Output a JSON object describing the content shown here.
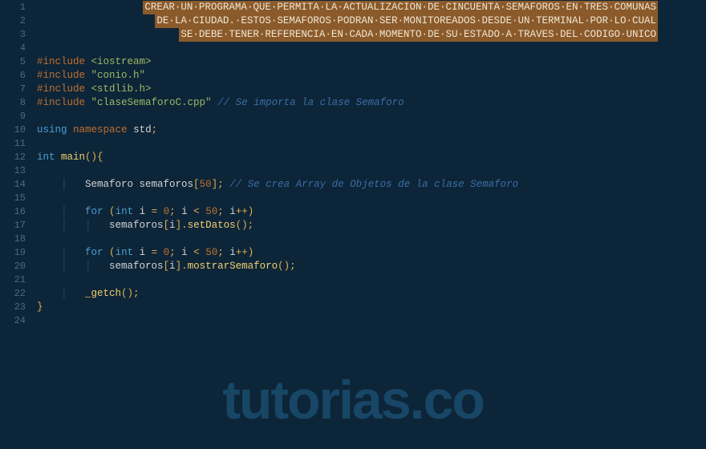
{
  "watermark": "tutorias.co",
  "lines": [
    {
      "num": "1",
      "type": "banner",
      "indent": 1,
      "text": "CREAR UN PROGRAMA QUE PERMITA LA ACTUALIZACION DE CINCUENTA SEMAFOROS EN TRES COMUNAS"
    },
    {
      "num": "2",
      "type": "banner",
      "indent": 1,
      "text": "DE LA CIUDAD. ESTOS SEMAFOROS PODRAN SER MONITOREADOS DESDE UN TERMINAL POR LO CUAL"
    },
    {
      "num": "3",
      "type": "banner",
      "indent": 1,
      "text": "SE DEBE TENER REFERENCIA EN CADA MOMENTO DE SU ESTADO A TRAVES DEL CODIGO UNICO"
    },
    {
      "num": "4",
      "type": "blank"
    },
    {
      "num": "5",
      "type": "include_angle",
      "file": "iostream"
    },
    {
      "num": "6",
      "type": "include_quote",
      "file": "conio.h"
    },
    {
      "num": "7",
      "type": "include_angle",
      "file": "stdlib.h"
    },
    {
      "num": "8",
      "type": "include_quote_comment",
      "file": "claseSemaforoC.cpp",
      "comment": "// Se importa la clase Semaforo"
    },
    {
      "num": "9",
      "type": "blank"
    },
    {
      "num": "10",
      "type": "using",
      "text_using": "using",
      "text_namespace": "namespace",
      "text_std": "std"
    },
    {
      "num": "11",
      "type": "blank"
    },
    {
      "num": "12",
      "type": "main",
      "int": "int",
      "main": "main"
    },
    {
      "num": "13",
      "type": "blank"
    },
    {
      "num": "14",
      "type": "decl",
      "cls": "Semaforo",
      "var": "semaforos",
      "num_v": "50",
      "comment": "// Se crea Array de Objetos de la clase Semaforo"
    },
    {
      "num": "15",
      "type": "blank"
    },
    {
      "num": "16",
      "type": "for",
      "kw_for": "for",
      "kw_int": "int",
      "var": "i",
      "zero": "0",
      "lim": "50"
    },
    {
      "num": "17",
      "type": "call",
      "arr": "semaforos",
      "idx": "i",
      "method": "setDatos"
    },
    {
      "num": "18",
      "type": "blank"
    },
    {
      "num": "19",
      "type": "for",
      "kw_for": "for",
      "kw_int": "int",
      "var": "i",
      "zero": "0",
      "lim": "50"
    },
    {
      "num": "20",
      "type": "call",
      "arr": "semaforos",
      "idx": "i",
      "method": "mostrarSemaforo"
    },
    {
      "num": "21",
      "type": "blank"
    },
    {
      "num": "22",
      "type": "getch",
      "fn": "_getch"
    },
    {
      "num": "23",
      "type": "closebrace"
    },
    {
      "num": "24",
      "type": "blank"
    }
  ]
}
